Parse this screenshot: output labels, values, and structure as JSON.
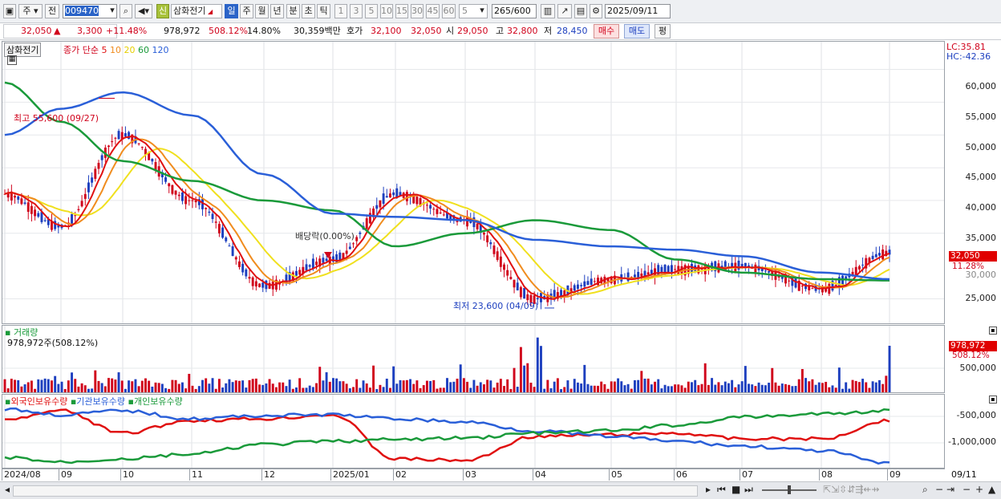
{
  "toolbar": {
    "market": "주",
    "prev": "전",
    "code": "009470",
    "stock_tag": "신",
    "stock_name": "삼화전기",
    "periods": [
      "일",
      "주",
      "월",
      "년",
      "분",
      "초",
      "틱"
    ],
    "intervals": [
      "1",
      "3",
      "5",
      "10",
      "15",
      "30",
      "45",
      "60"
    ],
    "interval_value": "5",
    "count": "265",
    "count_total": "/600",
    "date": "2025/09/11"
  },
  "quote": {
    "price": "32,050",
    "change_arrow": "▲",
    "change": "3,300",
    "change_pct": "+11.48%",
    "volume": "978,972",
    "volume_ratio": "508.12%",
    "turnover": "14.80%",
    "amount": "30,359백만",
    "ask_label": "호가",
    "ask1": "32,100",
    "ask2": "32,050",
    "open_label": "시",
    "open": "29,050",
    "high_label": "고",
    "high": "32,800",
    "low_label": "저",
    "low": "28,450",
    "buy": "매수",
    "sell": "매도",
    "eval": "평"
  },
  "price_panel": {
    "name": "삼화전기",
    "legend_prefix": "종가 단순",
    "ma_periods": [
      "5",
      "10",
      "20",
      "60",
      "120"
    ],
    "ma_colors": [
      "#e01010",
      "#f08c1e",
      "#f0e01e",
      "#1a9a3a",
      "#2a5fd8"
    ],
    "lc": "LC:35.81",
    "hc": "HC:-42.36",
    "y_ticks": [
      "60,000",
      "55,000",
      "50,000",
      "45,000",
      "40,000",
      "35,000",
      "30,000",
      "25,000"
    ],
    "last_price": "32,050",
    "last_pct": "11.28%",
    "high_note": "최고 55,600 (09/27)",
    "low_note": "최저 23,600 (04/09)",
    "dividend_note": "배당락(0.00%)"
  },
  "volume_panel": {
    "title": "거래량",
    "value": "978,972주(508.12%)",
    "y_tick": "500,000",
    "last_value": "978,972",
    "last_pct": "508.12%"
  },
  "holding_panel": {
    "series": [
      "외국인보유수량",
      "기관보유수량",
      "개인보유수량"
    ],
    "series_colors": [
      "#e01010",
      "#2a5fd8",
      "#1a9a3a"
    ],
    "y_ticks": [
      "-500,000",
      "-1,000,000"
    ]
  },
  "x_axis": {
    "labels": [
      "2024/08",
      "09",
      "10",
      "11",
      "12",
      "2025/01",
      "02",
      "03",
      "04",
      "05",
      "06",
      "07",
      "08",
      "09"
    ],
    "right_label": "09/11"
  },
  "chart_data": {
    "type": "line",
    "title": "삼화전기",
    "x": [
      "2024/08",
      "09",
      "10",
      "11",
      "12",
      "2025/01",
      "02",
      "03",
      "04",
      "05",
      "06",
      "07",
      "08",
      "09"
    ],
    "ylim": [
      22000,
      63000
    ],
    "series": [
      {
        "name": "종가",
        "values": [
          41000,
          36000,
          50000,
          40000,
          27000,
          31000,
          41000,
          37000,
          25000,
          28000,
          29500,
          30000,
          26500,
          32050
        ]
      },
      {
        "name": "120",
        "values": [
          50000,
          54000,
          56500,
          53000,
          44000,
          38000,
          37500,
          37000,
          34000,
          33000,
          32500,
          31500,
          29000,
          28000
        ]
      },
      {
        "name": "60",
        "values": [
          58000,
          52000,
          46000,
          43000,
          40000,
          38500,
          33000,
          35000,
          37000,
          35500,
          31000,
          29000,
          28000,
          27800
        ]
      }
    ],
    "high": {
      "value": 55600,
      "date": "09/27"
    },
    "low": {
      "value": 23600,
      "date": "04/09"
    }
  }
}
